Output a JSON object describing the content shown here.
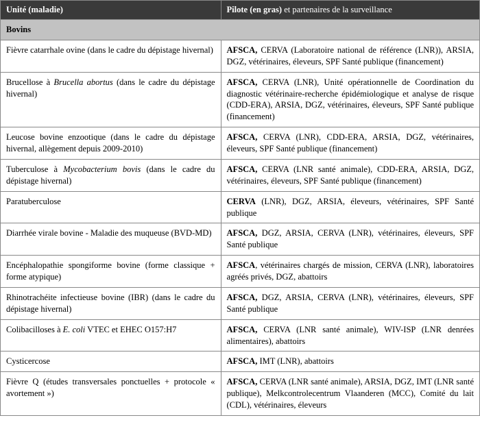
{
  "header": {
    "col1": "Unité (maladie)",
    "col2_bold": "Pilote (en gras) ",
    "col2_rest": "et partenaires de la surveillance"
  },
  "section_label": "Bovins",
  "rows": [
    {
      "disease_pre": "Fièvre catarrhale ovine (dans le cadre du dépistage hivernal)",
      "disease_post": "",
      "pilote": "AFSCA,",
      "partners": " CERVA (Laboratoire national de référence (LNR)), ARSIA, DGZ, vétérinaires, éleveurs, SPF Santé publique (financement)"
    },
    {
      "disease_pre": "Brucellose à ",
      "disease_em": "Brucella abortus",
      "disease_post": " (dans le cadre du dépistage hivernal)",
      "pilote": "AFSCA,",
      "partners": " CERVA (LNR), Unité opérationnelle de Coordination du diagnostic vétérinaire-recherche épidémiologique et analyse de risque (CDD-ERA), ARSIA, DGZ, vétérinaires, éleveurs, SPF Santé publique (financement)"
    },
    {
      "disease_pre": "Leucose bovine enzootique (dans le cadre du dépistage hivernal, allègement depuis 2009-2010)",
      "disease_post": "",
      "pilote": "AFSCA,",
      "partners": " CERVA (LNR), CDD-ERA, ARSIA, DGZ, vétérinaires, éleveurs, SPF Santé publique (financement)"
    },
    {
      "disease_pre": "Tuberculose à ",
      "disease_em": "Mycobacterium bovis",
      "disease_post": " (dans le cadre du dépistage hivernal)",
      "pilote": "AFSCA,",
      "partners": " CERVA (LNR santé animale), CDD-ERA, ARSIA, DGZ, vétérinaires, éleveurs, SPF Santé publique (financement)"
    },
    {
      "disease_pre": "Paratuberculose",
      "disease_post": "",
      "pilote": "CERVA",
      "partners": " (LNR), DGZ, ARSIA, éleveurs, vétérinaires, SPF Santé publique"
    },
    {
      "disease_pre": "Diarrhée virale bovine - Maladie des muqueuse (BVD-MD)",
      "disease_post": "",
      "pilote": "AFSCA,",
      "partners": " DGZ, ARSIA, CERVA (LNR), vétérinaires, éleveurs, SPF Santé publique"
    },
    {
      "disease_pre": "Encéphalopathie spongiforme bovine (forme classique + forme atypique)",
      "disease_post": "",
      "pilote": "AFSCA",
      "partners": ", vétérinaires chargés de mission, CERVA (LNR), laboratoires agréés privés, DGZ, abattoirs"
    },
    {
      "disease_pre": "Rhinotrachéite infectieuse bovine (IBR) (dans le cadre du dépistage hivernal)",
      "disease_post": "",
      "pilote": "AFSCA,",
      "partners": " DGZ, ARSIA, CERVA (LNR), vétérinaires, éleveurs, SPF Santé publique"
    },
    {
      "disease_pre": "Colibacilloses à ",
      "disease_em": "E. coli",
      "disease_post": " VTEC et EHEC O157:H7",
      "pilote": "AFSCA,",
      "partners": " CERVA (LNR santé animale), WIV-ISP (LNR denrées alimentaires), abattoirs"
    },
    {
      "disease_pre": "Cysticercose",
      "disease_post": "",
      "pilote": "AFSCA,",
      "partners": " IMT (LNR), abattoirs"
    },
    {
      "disease_pre": "Fièvre Q (études transversales ponctuelles + protocole « avortement »)",
      "disease_post": "",
      "pilote": "AFSCA,",
      "partners": " CERVA (LNR santé animale), ARSIA, DGZ, IMT (LNR santé publique), Melkcontrolecentrum Vlaanderen (MCC), Comité du lait (CDL), vétérinaires, éleveurs"
    }
  ]
}
